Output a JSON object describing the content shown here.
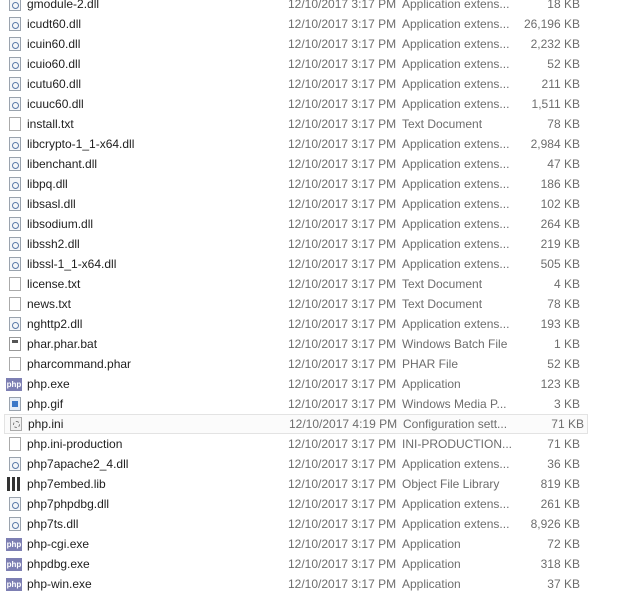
{
  "files": [
    {
      "name": "gmodule-2.dll",
      "date": "12/10/2017 3:17 PM",
      "type": "Application extens...",
      "size": "18 KB",
      "icon": "dll"
    },
    {
      "name": "icudt60.dll",
      "date": "12/10/2017 3:17 PM",
      "type": "Application extens...",
      "size": "26,196 KB",
      "icon": "dll"
    },
    {
      "name": "icuin60.dll",
      "date": "12/10/2017 3:17 PM",
      "type": "Application extens...",
      "size": "2,232 KB",
      "icon": "dll"
    },
    {
      "name": "icuio60.dll",
      "date": "12/10/2017 3:17 PM",
      "type": "Application extens...",
      "size": "52 KB",
      "icon": "dll"
    },
    {
      "name": "icutu60.dll",
      "date": "12/10/2017 3:17 PM",
      "type": "Application extens...",
      "size": "211 KB",
      "icon": "dll"
    },
    {
      "name": "icuuc60.dll",
      "date": "12/10/2017 3:17 PM",
      "type": "Application extens...",
      "size": "1,511 KB",
      "icon": "dll"
    },
    {
      "name": "install.txt",
      "date": "12/10/2017 3:17 PM",
      "type": "Text Document",
      "size": "78 KB",
      "icon": "txt"
    },
    {
      "name": "libcrypto-1_1-x64.dll",
      "date": "12/10/2017 3:17 PM",
      "type": "Application extens...",
      "size": "2,984 KB",
      "icon": "dll"
    },
    {
      "name": "libenchant.dll",
      "date": "12/10/2017 3:17 PM",
      "type": "Application extens...",
      "size": "47 KB",
      "icon": "dll"
    },
    {
      "name": "libpq.dll",
      "date": "12/10/2017 3:17 PM",
      "type": "Application extens...",
      "size": "186 KB",
      "icon": "dll"
    },
    {
      "name": "libsasl.dll",
      "date": "12/10/2017 3:17 PM",
      "type": "Application extens...",
      "size": "102 KB",
      "icon": "dll"
    },
    {
      "name": "libsodium.dll",
      "date": "12/10/2017 3:17 PM",
      "type": "Application extens...",
      "size": "264 KB",
      "icon": "dll"
    },
    {
      "name": "libssh2.dll",
      "date": "12/10/2017 3:17 PM",
      "type": "Application extens...",
      "size": "219 KB",
      "icon": "dll"
    },
    {
      "name": "libssl-1_1-x64.dll",
      "date": "12/10/2017 3:17 PM",
      "type": "Application extens...",
      "size": "505 KB",
      "icon": "dll"
    },
    {
      "name": "license.txt",
      "date": "12/10/2017 3:17 PM",
      "type": "Text Document",
      "size": "4 KB",
      "icon": "txt"
    },
    {
      "name": "news.txt",
      "date": "12/10/2017 3:17 PM",
      "type": "Text Document",
      "size": "78 KB",
      "icon": "txt"
    },
    {
      "name": "nghttp2.dll",
      "date": "12/10/2017 3:17 PM",
      "type": "Application extens...",
      "size": "193 KB",
      "icon": "dll"
    },
    {
      "name": "phar.phar.bat",
      "date": "12/10/2017 3:17 PM",
      "type": "Windows Batch File",
      "size": "1 KB",
      "icon": "bat"
    },
    {
      "name": "pharcommand.phar",
      "date": "12/10/2017 3:17 PM",
      "type": "PHAR File",
      "size": "52 KB",
      "icon": "txt"
    },
    {
      "name": "php.exe",
      "date": "12/10/2017 3:17 PM",
      "type": "Application",
      "size": "123 KB",
      "icon": "php"
    },
    {
      "name": "php.gif",
      "date": "12/10/2017 3:17 PM",
      "type": "Windows Media P...",
      "size": "3 KB",
      "icon": "gif"
    },
    {
      "name": "php.ini",
      "date": "12/10/2017 4:19 PM",
      "type": "Configuration sett...",
      "size": "71 KB",
      "icon": "ini",
      "hover": true
    },
    {
      "name": "php.ini-production",
      "date": "12/10/2017 3:17 PM",
      "type": "INI-PRODUCTION...",
      "size": "71 KB",
      "icon": "txt"
    },
    {
      "name": "php7apache2_4.dll",
      "date": "12/10/2017 3:17 PM",
      "type": "Application extens...",
      "size": "36 KB",
      "icon": "dll"
    },
    {
      "name": "php7embed.lib",
      "date": "12/10/2017 3:17 PM",
      "type": "Object File Library",
      "size": "819 KB",
      "icon": "lib"
    },
    {
      "name": "php7phpdbg.dll",
      "date": "12/10/2017 3:17 PM",
      "type": "Application extens...",
      "size": "261 KB",
      "icon": "dll"
    },
    {
      "name": "php7ts.dll",
      "date": "12/10/2017 3:17 PM",
      "type": "Application extens...",
      "size": "8,926 KB",
      "icon": "dll"
    },
    {
      "name": "php-cgi.exe",
      "date": "12/10/2017 3:17 PM",
      "type": "Application",
      "size": "72 KB",
      "icon": "php"
    },
    {
      "name": "phpdbg.exe",
      "date": "12/10/2017 3:17 PM",
      "type": "Application",
      "size": "318 KB",
      "icon": "php"
    },
    {
      "name": "php-win.exe",
      "date": "12/10/2017 3:17 PM",
      "type": "Application",
      "size": "37 KB",
      "icon": "php"
    }
  ],
  "php_icon_label": "php"
}
